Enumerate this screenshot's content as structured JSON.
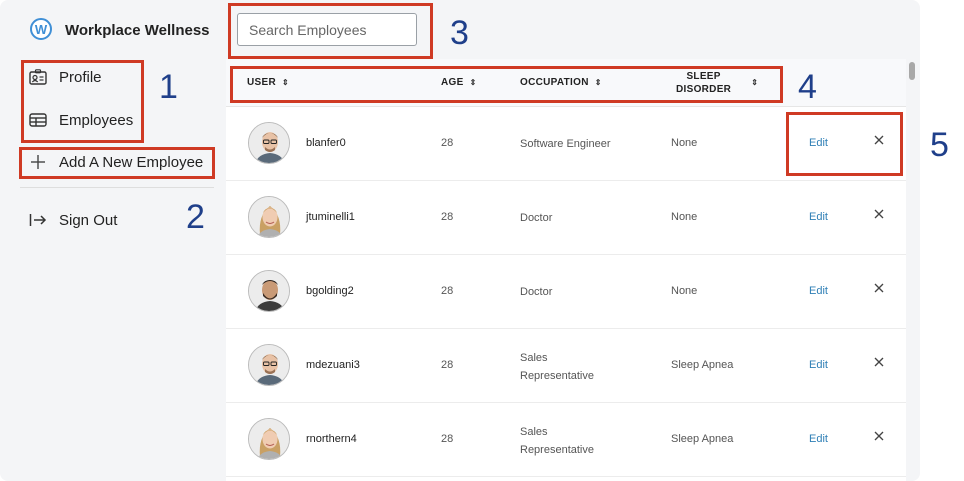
{
  "app": {
    "title": "Workplace Wellness",
    "logo_letter": "W"
  },
  "sidebar": {
    "items": [
      {
        "label": "Profile",
        "icon": "profile-card-icon"
      },
      {
        "label": "Employees",
        "icon": "employees-table-icon"
      },
      {
        "label": "Add A New Employee",
        "icon": "plus-icon"
      },
      {
        "label": "Sign Out",
        "icon": "sign-out-arrow-icon"
      }
    ]
  },
  "search": {
    "placeholder": "Search Employees",
    "value": ""
  },
  "table": {
    "columns": [
      {
        "label": "USER"
      },
      {
        "label": "AGE"
      },
      {
        "label": "OCCUPATION"
      },
      {
        "label_line1": "SLEEP",
        "label_line2": "DISORDER"
      }
    ],
    "rows": [
      {
        "user": "blanfer0",
        "age": "28",
        "occupation_line1": "Software Engineer",
        "occupation_line2": "",
        "sleep_disorder": "None",
        "edit": "Edit",
        "delete": "X"
      },
      {
        "user": "jtuminelli1",
        "age": "28",
        "occupation_line1": "Doctor",
        "occupation_line2": "",
        "sleep_disorder": "None",
        "edit": "Edit",
        "delete": "X"
      },
      {
        "user": "bgolding2",
        "age": "28",
        "occupation_line1": "Doctor",
        "occupation_line2": "",
        "sleep_disorder": "None",
        "edit": "Edit",
        "delete": "X"
      },
      {
        "user": "mdezuani3",
        "age": "28",
        "occupation_line1": "Sales",
        "occupation_line2": "Representative",
        "sleep_disorder": "Sleep Apnea",
        "edit": "Edit",
        "delete": "X"
      },
      {
        "user": "rnorthern4",
        "age": "28",
        "occupation_line1": "Sales",
        "occupation_line2": "Representative",
        "sleep_disorder": "Sleep Apnea",
        "edit": "Edit",
        "delete": "X"
      }
    ]
  },
  "annotations": [
    "1",
    "2",
    "3",
    "4",
    "5"
  ],
  "colors": {
    "accent": "#3f8fd6",
    "link": "#2f7fb6",
    "callout": "#cf3a24",
    "callout_number": "#1f3f8a"
  }
}
